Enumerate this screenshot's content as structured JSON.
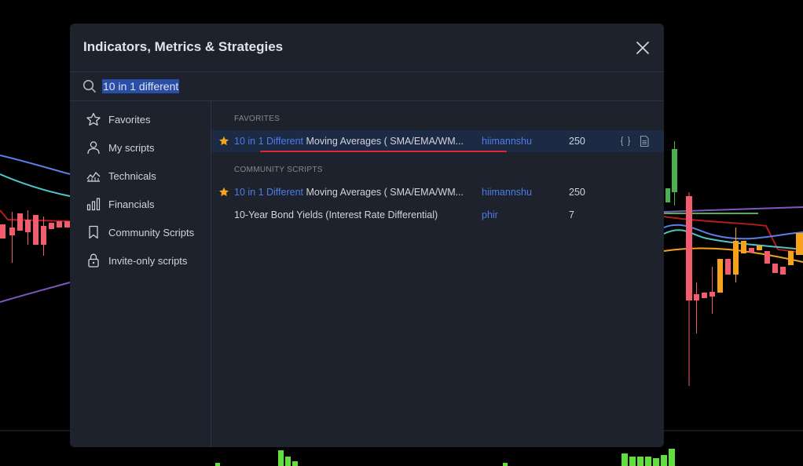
{
  "dialog": {
    "title": "Indicators, Metrics & Strategies",
    "close_icon": "close-icon"
  },
  "search": {
    "value": "10 in 1 different",
    "icon": "search-icon"
  },
  "sidebar": {
    "items": [
      {
        "label": "Favorites",
        "icon": "star-outline-icon"
      },
      {
        "label": "My scripts",
        "icon": "user-icon"
      },
      {
        "label": "Technicals",
        "icon": "chart-line-icon"
      },
      {
        "label": "Financials",
        "icon": "bar-chart-icon"
      },
      {
        "label": "Community Scripts",
        "icon": "bookmark-icon"
      },
      {
        "label": "Invite-only scripts",
        "icon": "lock-icon"
      }
    ]
  },
  "sections": {
    "favorites": {
      "heading": "FAVORITES",
      "rows": [
        {
          "name_highlight": "10 in 1 Different",
          "name_rest": " Moving Averages ( SMA/EMA/WM...",
          "author": "hiimannshu",
          "count": "250",
          "starred": true
        }
      ]
    },
    "community": {
      "heading": "COMMUNITY SCRIPTS",
      "rows": [
        {
          "name_highlight": "10 in 1 Different",
          "name_rest": " Moving Averages ( SMA/EMA/WM...",
          "author": "hiimannshu",
          "count": "250",
          "starred": true
        },
        {
          "name_highlight": "",
          "name_rest": "10-Year Bond Yields (Interest Rate Differential)",
          "author": "phir",
          "count": "7",
          "starred": false
        }
      ]
    }
  },
  "colors": {
    "accent": "#2962ff",
    "link": "#4c7ce8",
    "star": "#f7a21b",
    "underline": "#e0273b",
    "bull": "#4caf50",
    "bear": "#f23645",
    "orange_candle": "#f7a21b"
  }
}
